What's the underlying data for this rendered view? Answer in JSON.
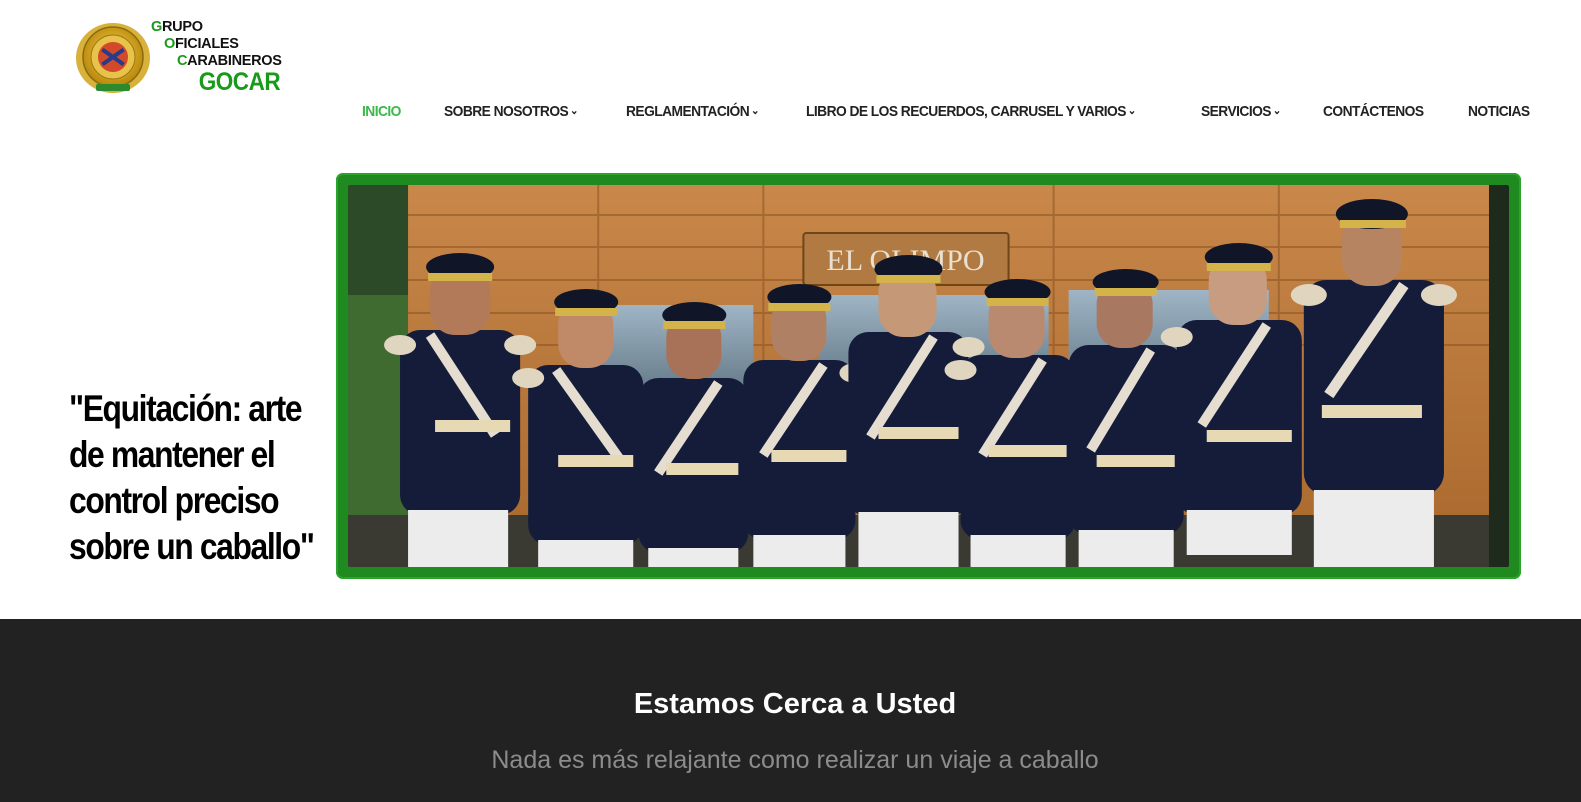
{
  "logo": {
    "lines": [
      {
        "cap": "G",
        "rest": "RUPO"
      },
      {
        "cap": "O",
        "rest": "FICIALES"
      },
      {
        "cap": "C",
        "rest": "ARABINEROS"
      }
    ],
    "brand": "GOCAR"
  },
  "nav": {
    "items": [
      {
        "label": "INICIO",
        "active": true,
        "dropdown": false
      },
      {
        "label": "SOBRE NOSOTROS",
        "active": false,
        "dropdown": true
      },
      {
        "label": "REGLAMENTACIÓN",
        "active": false,
        "dropdown": true
      },
      {
        "label": "LIBRO DE LOS RECUERDOS, CARRUSEL Y VARIOS",
        "active": false,
        "dropdown": true
      },
      {
        "label": "SERVICIOS",
        "active": false,
        "dropdown": true
      },
      {
        "label": "CONTÁCTENOS",
        "active": false,
        "dropdown": false
      },
      {
        "label": "NOTICIAS",
        "active": false,
        "dropdown": false
      }
    ],
    "dropdown_icon": "chevron-down-icon",
    "active_color": "#3bb84a"
  },
  "hero": {
    "quote": "\"Equitación: arte de mantener el control preciso sobre un caballo\"",
    "photo_sign": "EL OLIMPO",
    "frame_color": "#1f8a1f"
  },
  "section": {
    "title": "Estamos Cerca a Usted",
    "subtitle": "Nada es más relajante como realizar un viaje a caballo",
    "background": "#222222"
  }
}
